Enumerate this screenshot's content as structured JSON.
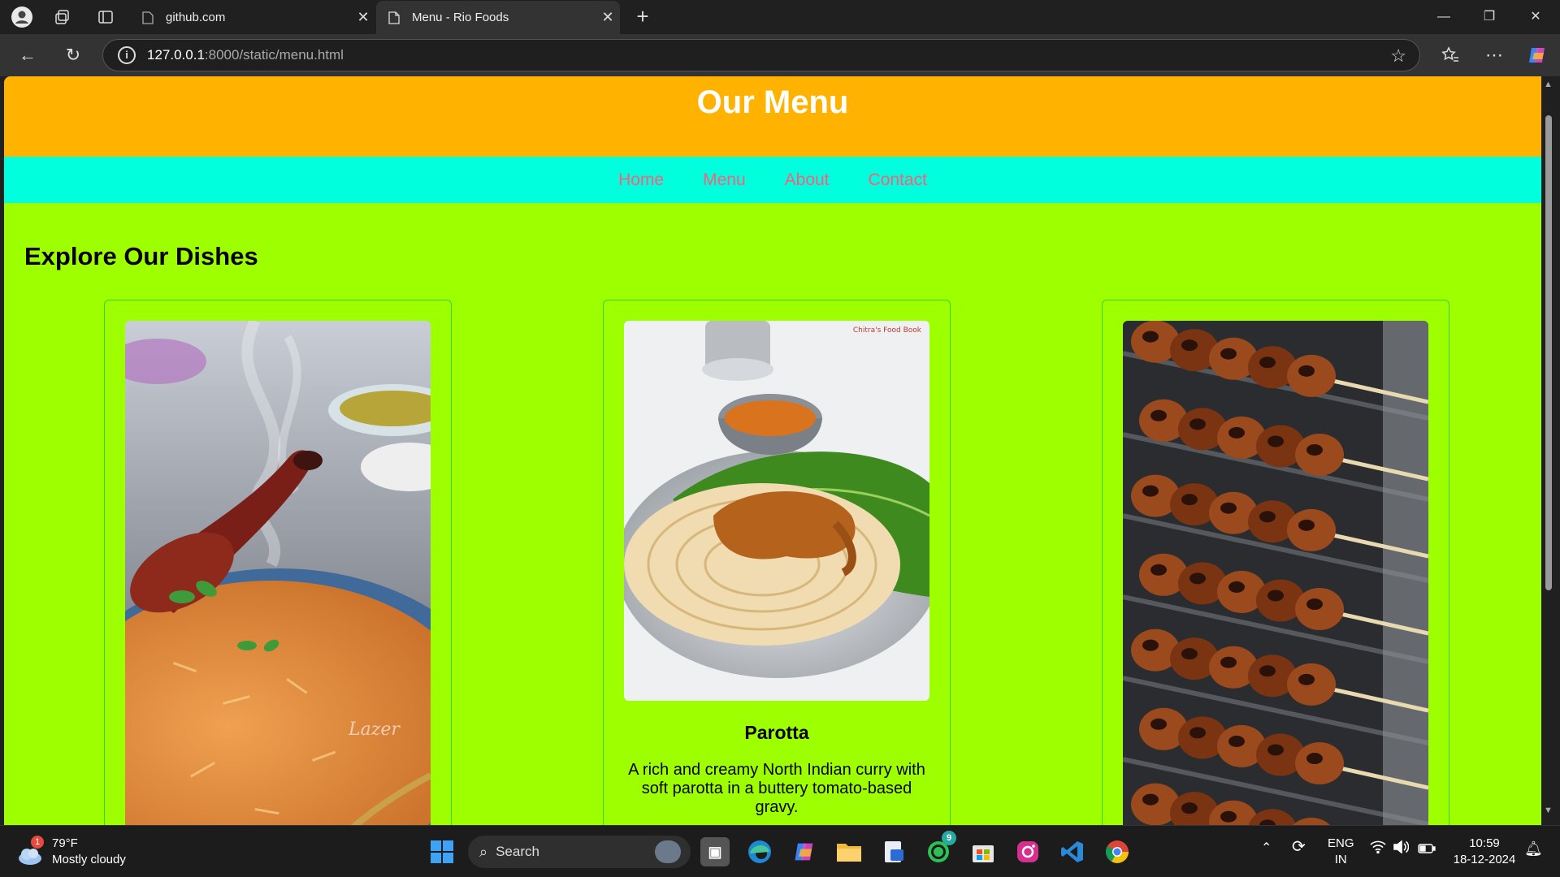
{
  "browser": {
    "tabs": [
      {
        "title": "github.com",
        "active": false
      },
      {
        "title": "Menu - Rio Foods",
        "active": true
      }
    ],
    "url_host": "127.0.0.1",
    "url_rest": ":8000/static/menu.html"
  },
  "site": {
    "header_title": "Our Menu",
    "nav": [
      "Home",
      "Menu",
      "About",
      "Contact"
    ],
    "section_title": "Explore Our Dishes",
    "dishes": [
      {
        "name": "",
        "description": "",
        "image": "chicken-biryani-photo"
      },
      {
        "name": "Parotta",
        "description": "A rich and creamy North Indian curry with soft parotta in a buttery tomato-based gravy.",
        "image": "parotta-with-curry-photo",
        "image_watermark": "Chitra's Food Book"
      },
      {
        "name": "",
        "description": "",
        "image": "grilled-chicken-skewers-photo"
      }
    ],
    "colors": {
      "header": "#ffb300",
      "nav": "#00ffdc",
      "nav_link": "#ff5b7d",
      "body": "#9eff00"
    }
  },
  "taskbar": {
    "weather_badge": "1",
    "weather_temp": "79°F",
    "weather_desc": "Mostly cloudy",
    "search_label": "Search",
    "whatsapp_badge": "9",
    "lang_line1": "ENG",
    "lang_line2": "IN",
    "time": "10:59",
    "date": "18-12-2024"
  }
}
